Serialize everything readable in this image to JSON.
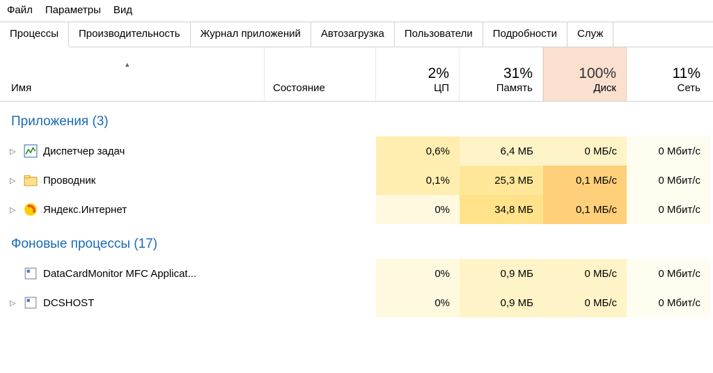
{
  "menu": {
    "file": "Файл",
    "options": "Параметры",
    "view": "Вид"
  },
  "tabs": {
    "processes": "Процессы",
    "performance": "Производительность",
    "appHistory": "Журнал приложений",
    "startup": "Автозагрузка",
    "users": "Пользователи",
    "details": "Подробности",
    "services": "Служ"
  },
  "headers": {
    "name": "Имя",
    "state": "Состояние",
    "cpu": {
      "pct": "2%",
      "label": "ЦП"
    },
    "memory": {
      "pct": "31%",
      "label": "Память"
    },
    "disk": {
      "pct": "100%",
      "label": "Диск"
    },
    "network": {
      "pct": "11%",
      "label": "Сеть"
    }
  },
  "groups": {
    "apps": "Приложения (3)",
    "bg": "Фоновые процессы (17)"
  },
  "rows": {
    "r1": {
      "name": "Диспетчер задач",
      "cpu": "0,6%",
      "mem": "6,4 МБ",
      "disk": "0 МБ/с",
      "net": "0 Мбит/с"
    },
    "r2": {
      "name": "Проводник",
      "cpu": "0,1%",
      "mem": "25,3 МБ",
      "disk": "0,1 МБ/с",
      "net": "0 Мбит/с"
    },
    "r3": {
      "name": "Яндекс.Интернет",
      "cpu": "0%",
      "mem": "34,8 МБ",
      "disk": "0,1 МБ/с",
      "net": "0 Мбит/с"
    },
    "r4": {
      "name": "DataCardMonitor MFC Applicat...",
      "cpu": "0%",
      "mem": "0,9 МБ",
      "disk": "0 МБ/с",
      "net": "0 Мбит/с"
    },
    "r5": {
      "name": "DCSHOST",
      "cpu": "0%",
      "mem": "0,9 МБ",
      "disk": "0 МБ/с",
      "net": "0 Мбит/с"
    }
  }
}
